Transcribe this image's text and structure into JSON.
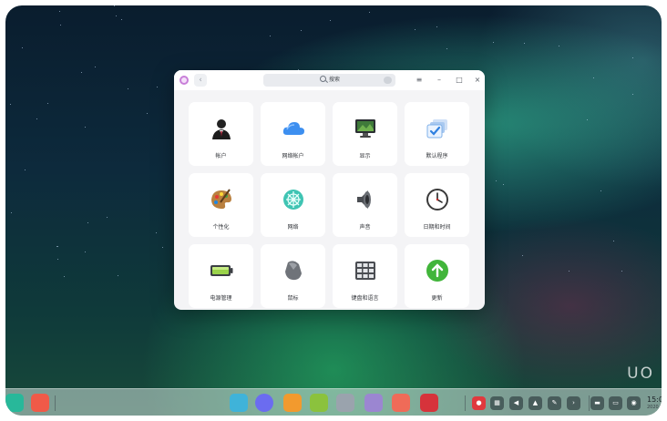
{
  "desktop": {
    "watermark": "UO"
  },
  "window": {
    "search_placeholder": "搜索",
    "back_label": "‹",
    "menu_label": "≡",
    "minimize_label": "–",
    "maximize_label": "□",
    "close_label": "×",
    "tiles": [
      {
        "label": "帐户",
        "icon": "account-icon"
      },
      {
        "label": "网络帐户",
        "icon": "cloud-icon"
      },
      {
        "label": "显示",
        "icon": "display-icon"
      },
      {
        "label": "默认程序",
        "icon": "default-apps-icon"
      },
      {
        "label": "个性化",
        "icon": "palette-icon"
      },
      {
        "label": "网络",
        "icon": "network-icon"
      },
      {
        "label": "声音",
        "icon": "speaker-icon"
      },
      {
        "label": "日期和时间",
        "icon": "clock-icon"
      },
      {
        "label": "电源管理",
        "icon": "battery-icon"
      },
      {
        "label": "鼠标",
        "icon": "mouse-icon"
      },
      {
        "label": "键盘和语言",
        "icon": "keyboard-icon"
      },
      {
        "label": "更新",
        "icon": "update-icon"
      }
    ]
  },
  "dock": {
    "apps": [
      {
        "name": "launcher-icon",
        "color": "#28b89a"
      },
      {
        "name": "screen-recorder-icon",
        "color": "#f05a48"
      },
      {
        "name": "file-manager-icon",
        "color": "#3fb3d9"
      },
      {
        "name": "browser-icon",
        "color": "#6b6cf0"
      },
      {
        "name": "app-store-icon",
        "color": "#f29a2e"
      },
      {
        "name": "music-icon",
        "color": "#8bc23d"
      },
      {
        "name": "control-center-icon",
        "color": "#9aa3ad"
      },
      {
        "name": "font-manager-icon",
        "color": "#9b86d1"
      },
      {
        "name": "video-icon",
        "color": "#ef6b58"
      },
      {
        "name": "terminal-icon",
        "color": "#d6333b"
      }
    ],
    "tray": [
      {
        "name": "tray-app-icon",
        "glyph": "●"
      },
      {
        "name": "keyboard-tray-icon",
        "glyph": "▦"
      },
      {
        "name": "volume-icon",
        "glyph": "◀"
      },
      {
        "name": "notification-icon",
        "glyph": "▲"
      },
      {
        "name": "pen-icon",
        "glyph": "✎"
      },
      {
        "name": "expand-tray-icon",
        "glyph": "›"
      },
      {
        "name": "multitask-icon",
        "glyph": "▬"
      },
      {
        "name": "show-desktop-icon",
        "glyph": "▭"
      },
      {
        "name": "power-icon",
        "glyph": "◉"
      }
    ],
    "time": "15:0",
    "date": "2020"
  }
}
